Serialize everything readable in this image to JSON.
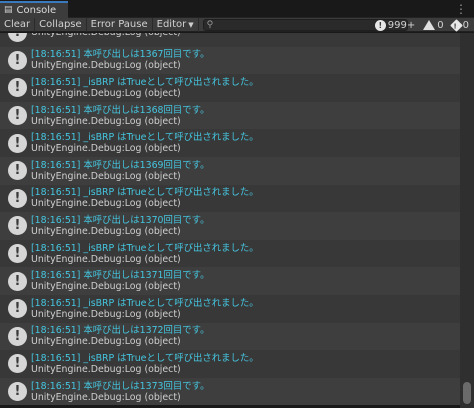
{
  "tab": {
    "title": "Console",
    "icon": "console-icon"
  },
  "toolbar": {
    "clear": "Clear",
    "collapse": "Collapse",
    "error_pause": "Error Pause",
    "editor": "Editor",
    "search_value": "",
    "info_count": "999+",
    "warning_count": "0",
    "error_count": "0"
  },
  "entries": [
    {
      "l1": "",
      "l2": "UnityEngine.Debug:Log (object)"
    },
    {
      "l1": "[18:16:51] 本呼び出しは1367回目です。",
      "l2": "UnityEngine.Debug:Log (object)"
    },
    {
      "l1": "[18:16:51] _isBRP はTrueとして呼び出されました。",
      "l2": "UnityEngine.Debug:Log (object)"
    },
    {
      "l1": "[18:16:51] 本呼び出しは1368回目です。",
      "l2": "UnityEngine.Debug:Log (object)"
    },
    {
      "l1": "[18:16:51] _isBRP はTrueとして呼び出されました。",
      "l2": "UnityEngine.Debug:Log (object)"
    },
    {
      "l1": "[18:16:51] 本呼び出しは1369回目です。",
      "l2": "UnityEngine.Debug:Log (object)"
    },
    {
      "l1": "[18:16:51] _isBRP はTrueとして呼び出されました。",
      "l2": "UnityEngine.Debug:Log (object)"
    },
    {
      "l1": "[18:16:51] 本呼び出しは1370回目です。",
      "l2": "UnityEngine.Debug:Log (object)"
    },
    {
      "l1": "[18:16:51] _isBRP はTrueとして呼び出されました。",
      "l2": "UnityEngine.Debug:Log (object)"
    },
    {
      "l1": "[18:16:51] 本呼び出しは1371回目です。",
      "l2": "UnityEngine.Debug:Log (object)"
    },
    {
      "l1": "[18:16:51] _isBRP はTrueとして呼び出されました。",
      "l2": "UnityEngine.Debug:Log (object)"
    },
    {
      "l1": "[18:16:51] 本呼び出しは1372回目です。",
      "l2": "UnityEngine.Debug:Log (object)"
    },
    {
      "l1": "[18:16:51] _isBRP はTrueとして呼び出されました。",
      "l2": "UnityEngine.Debug:Log (object)"
    },
    {
      "l1": "[18:16:51] 本呼び出しは1373回目です。",
      "l2": "UnityEngine.Debug:Log (object)"
    }
  ],
  "colors": {
    "message": "#45c6e0",
    "tab_accent": "#3a79bb"
  }
}
